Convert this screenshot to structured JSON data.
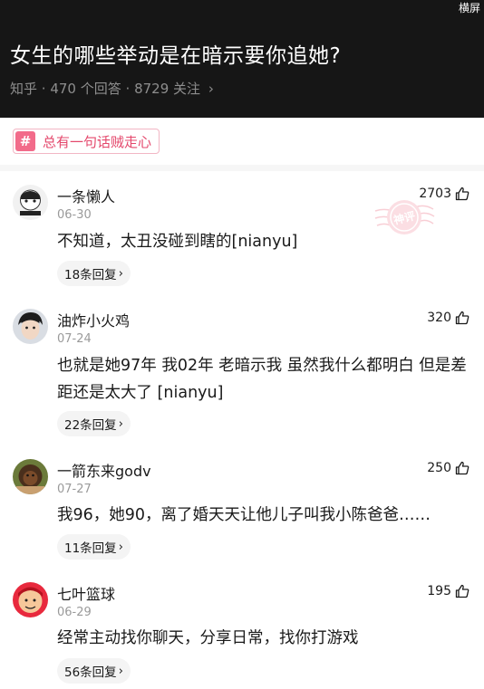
{
  "corner_label": "横屏",
  "question": {
    "title": "女生的哪些举动是在暗示要你追她?",
    "source": "知乎",
    "answers": "470 个回答",
    "follows": "8729 关注"
  },
  "topic": {
    "icon": "hash-icon",
    "text": "总有一句话贼走心",
    "color": "#e4486c"
  },
  "comments": [
    {
      "name": "一条懒人",
      "date": "06-30",
      "likes": "2703",
      "text": "不知道，太丑没碰到瞎的[nianyu]",
      "replies": "18条回复"
    },
    {
      "name": "油炸小火鸡",
      "date": "07-24",
      "likes": "320",
      "text": "也就是她97年 我02年 老暗示我 虽然我什么都明白 但是差距还是太大了 [nianyu]",
      "replies": "22条回复"
    },
    {
      "name": "一箭东来godv",
      "date": "07-27",
      "likes": "250",
      "text": "我96，她90，离了婚天天让他儿子叫我小陈爸爸……",
      "replies": "11条回复"
    },
    {
      "name": "七叶篮球",
      "date": "06-29",
      "likes": "195",
      "text": "经常主动找你聊天，分享日常，找你打游戏",
      "replies": "56条回复"
    }
  ],
  "stamp": {
    "text": "神评",
    "color": "#f07c90"
  }
}
